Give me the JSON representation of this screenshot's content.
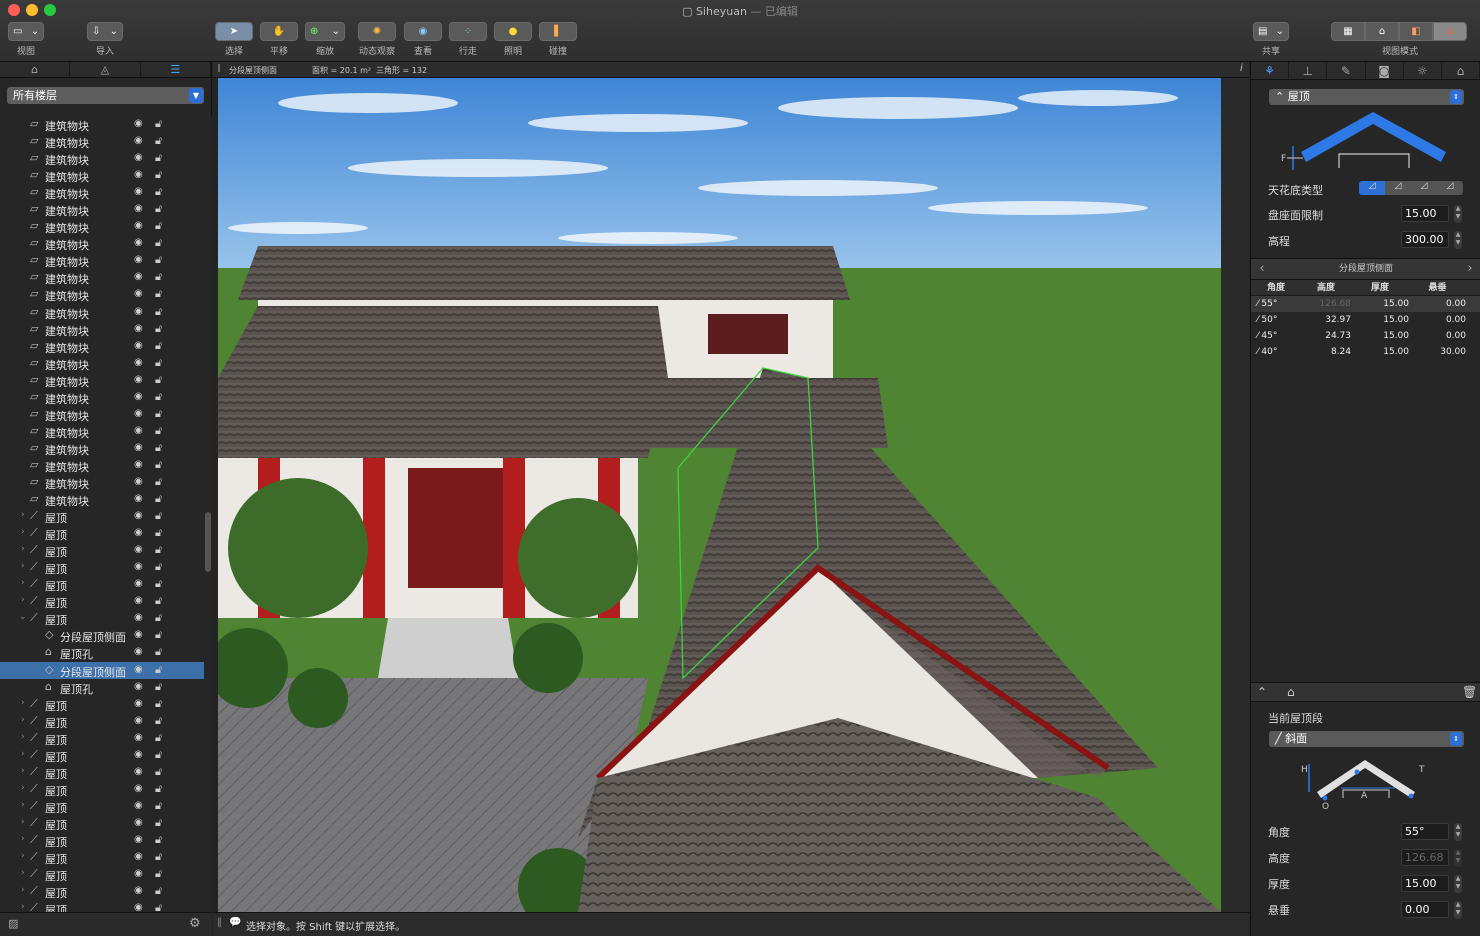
{
  "window": {
    "title": "Siheyuan",
    "subtitle": "— 已编辑"
  },
  "toolbar": {
    "view": "视图",
    "import": "导入",
    "select": "选择",
    "pan": "平移",
    "zoom": "缩放",
    "orbit": "动态观察",
    "look": "查看",
    "walk": "行走",
    "lighting": "照明",
    "collide": "碰撞",
    "share": "共享",
    "view_mode": "视图模式"
  },
  "colors": {
    "accent": "#2d6fd6",
    "selection": "#3d6fa8"
  },
  "left": {
    "tabs": [
      "building-icon",
      "ruler-icon",
      "list-icon"
    ],
    "floor_select": "所有楼层",
    "tree": [
      {
        "label": "建筑物块",
        "type": "block"
      },
      {
        "label": "建筑物块",
        "type": "block"
      },
      {
        "label": "建筑物块",
        "type": "block"
      },
      {
        "label": "建筑物块",
        "type": "block"
      },
      {
        "label": "建筑物块",
        "type": "block"
      },
      {
        "label": "建筑物块",
        "type": "block"
      },
      {
        "label": "建筑物块",
        "type": "block"
      },
      {
        "label": "建筑物块",
        "type": "block"
      },
      {
        "label": "建筑物块",
        "type": "block"
      },
      {
        "label": "建筑物块",
        "type": "block"
      },
      {
        "label": "建筑物块",
        "type": "block"
      },
      {
        "label": "建筑物块",
        "type": "block"
      },
      {
        "label": "建筑物块",
        "type": "block"
      },
      {
        "label": "建筑物块",
        "type": "block"
      },
      {
        "label": "建筑物块",
        "type": "block"
      },
      {
        "label": "建筑物块",
        "type": "block"
      },
      {
        "label": "建筑物块",
        "type": "block"
      },
      {
        "label": "建筑物块",
        "type": "block"
      },
      {
        "label": "建筑物块",
        "type": "block"
      },
      {
        "label": "建筑物块",
        "type": "block"
      },
      {
        "label": "建筑物块",
        "type": "block"
      },
      {
        "label": "建筑物块",
        "type": "block"
      },
      {
        "label": "建筑物块",
        "type": "block"
      },
      {
        "label": "屋顶",
        "type": "roof"
      },
      {
        "label": "屋顶",
        "type": "roof"
      },
      {
        "label": "屋顶",
        "type": "roof"
      },
      {
        "label": "屋顶",
        "type": "roof"
      },
      {
        "label": "屋顶",
        "type": "roof"
      },
      {
        "label": "屋顶",
        "type": "roof"
      },
      {
        "label": "屋顶",
        "type": "roof-open"
      },
      {
        "label": "分段屋顶侧面",
        "type": "child-seg"
      },
      {
        "label": "屋顶孔",
        "type": "child-hole"
      },
      {
        "label": "分段屋顶侧面",
        "type": "child-seg",
        "selected": true
      },
      {
        "label": "屋顶孔",
        "type": "child-hole"
      },
      {
        "label": "屋顶",
        "type": "roof"
      },
      {
        "label": "屋顶",
        "type": "roof"
      },
      {
        "label": "屋顶",
        "type": "roof"
      },
      {
        "label": "屋顶",
        "type": "roof"
      },
      {
        "label": "屋顶",
        "type": "roof"
      },
      {
        "label": "屋顶",
        "type": "roof"
      },
      {
        "label": "屋顶",
        "type": "roof"
      },
      {
        "label": "屋顶",
        "type": "roof"
      },
      {
        "label": "屋顶",
        "type": "roof"
      },
      {
        "label": "屋顶",
        "type": "roof"
      },
      {
        "label": "屋顶",
        "type": "roof"
      },
      {
        "label": "屋顶",
        "type": "roof"
      },
      {
        "label": "屋顶",
        "type": "roof"
      }
    ]
  },
  "viewport": {
    "info_name": "分段屋顶侧面",
    "info_area": "面积 = 20.1 m²",
    "info_tris": "三角形 = 132",
    "info_icon": "i"
  },
  "status": {
    "text": "选择对象。按 Shift 键以扩展选择。"
  },
  "inspector": {
    "type_select": "屋顶",
    "ceiling_type": "天花底类型",
    "plate_limit_label": "盘座面限制",
    "plate_limit": "15.00",
    "elevation_label": "高程",
    "elevation": "300.00",
    "diagram_label_f": "F",
    "segments_title": "分段屋顶侧面",
    "table_headers": [
      "角度",
      "高度",
      "厚度",
      "悬垂"
    ],
    "table_rows": [
      {
        "angle": "55°",
        "height": "126.68",
        "thickness": "15.00",
        "overhang": "0.00",
        "selected": true
      },
      {
        "angle": "50°",
        "height": "32.97",
        "thickness": "15.00",
        "overhang": "0.00"
      },
      {
        "angle": "45°",
        "height": "24.73",
        "thickness": "15.00",
        "overhang": "0.00"
      },
      {
        "angle": "40°",
        "height": "8.24",
        "thickness": "15.00",
        "overhang": "30.00"
      }
    ],
    "current_segment": "当前屋顶段",
    "segment_select": "斜面",
    "seg_diagram": {
      "h": "H",
      "t": "T",
      "a": "A",
      "o": "O"
    },
    "angle_label": "角度",
    "angle": "55°",
    "height_label": "高度",
    "height": "126.68",
    "thickness_label": "厚度",
    "thickness": "15.00",
    "overhang_label": "悬垂",
    "overhang": "0.00"
  }
}
